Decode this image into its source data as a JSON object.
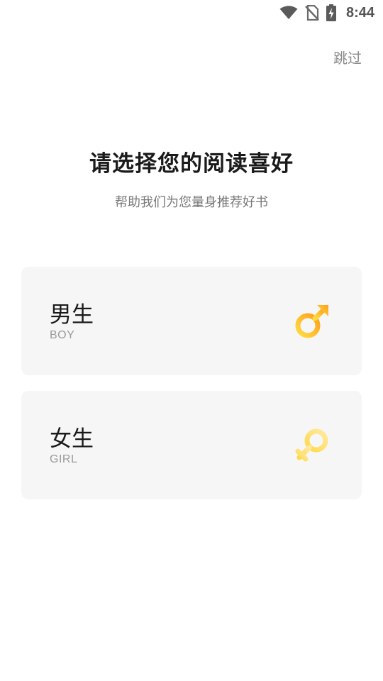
{
  "status_bar": {
    "time": "8:44",
    "icons": [
      "wifi-icon",
      "no-sim-icon",
      "battery-charging-icon"
    ]
  },
  "header": {
    "skip_label": "跳过"
  },
  "main": {
    "title": "请选择您的阅读喜好",
    "subtitle": "帮助我们为您量身推荐好书"
  },
  "options": [
    {
      "label": "男生",
      "sub_label": "BOY",
      "icon": "male-symbol-icon"
    },
    {
      "label": "女生",
      "sub_label": "GIRL",
      "icon": "female-symbol-icon"
    }
  ],
  "colors": {
    "accent_yellow": "#FFD23C",
    "accent_orange": "#FFAA1E",
    "card_bg": "#F6F6F7"
  }
}
